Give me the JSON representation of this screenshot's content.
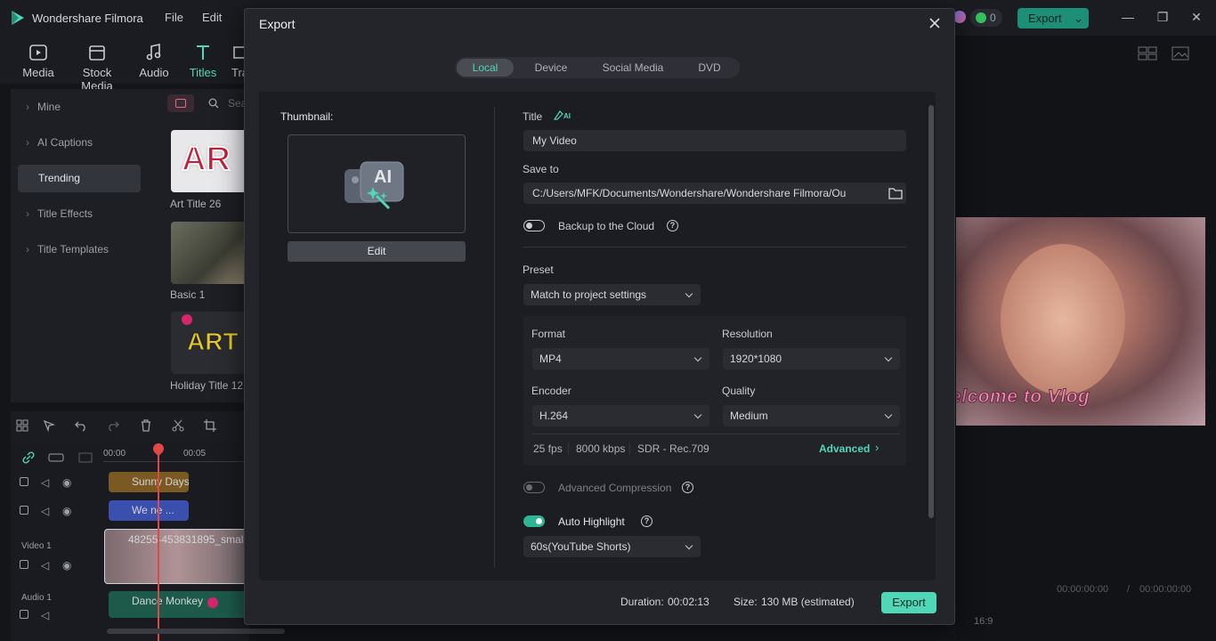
{
  "app": {
    "name": "Wondershare Filmora",
    "menu": [
      "File",
      "Edit"
    ],
    "credits": "0",
    "export_label": "Export"
  },
  "toolbar": [
    {
      "label": "Media",
      "icon": "media-icon"
    },
    {
      "label": "Stock Media",
      "icon": "stock-media-icon"
    },
    {
      "label": "Audio",
      "icon": "audio-icon"
    },
    {
      "label": "Titles",
      "icon": "titles-icon",
      "active": true
    },
    {
      "label": "Tra",
      "icon": "transitions-icon"
    }
  ],
  "leftnav": [
    "Mine",
    "AI Captions",
    "Trending",
    "Title Effects",
    "Title Templates"
  ],
  "search_placeholder": "Sea",
  "assets": [
    {
      "label": "Art Title 26",
      "art": "AR"
    },
    {
      "label": "Basic 1",
      "art": ""
    },
    {
      "label": "Holiday Title 12",
      "art": "ART"
    }
  ],
  "timeline": {
    "ruler": [
      "00:00",
      "00:05"
    ],
    "tracks": [
      {
        "name": "",
        "clip": "Sunny Days"
      },
      {
        "name": "",
        "clip": "We   ne ..."
      },
      {
        "name": "Video 1",
        "clip": "48255-453831895_small"
      },
      {
        "name": "Audio 1",
        "clip": "Dance Monkey"
      }
    ]
  },
  "preview": {
    "overlay_text": "elcome to Vlog",
    "timecode": "00:00:00:00",
    "timecode_total": "00:00:00:00",
    "aspect": "16:9"
  },
  "dialog": {
    "title": "Export",
    "tabs": [
      "Local",
      "Device",
      "Social Media",
      "DVD"
    ],
    "active_tab": "Local",
    "thumbnail_label": "Thumbnail:",
    "thumbnail_ai": "AI",
    "edit_label": "Edit",
    "title_label": "Title",
    "title_ai": "AI",
    "title_value": "My Video",
    "save_to_label": "Save to",
    "save_to_value": "C:/Users/MFK/Documents/Wondershare/Wondershare Filmora/Ou",
    "backup_label": "Backup to the Cloud",
    "backup_on": false,
    "preset_label": "Preset",
    "preset_value": "Match to project settings",
    "format_label": "Format",
    "format_value": "MP4",
    "resolution_label": "Resolution",
    "resolution_value": "1920*1080",
    "encoder_label": "Encoder",
    "encoder_value": "H.264",
    "quality_label": "Quality",
    "quality_value": "Medium",
    "fps": "25 fps",
    "bitrate": "8000 kbps",
    "color": "SDR - Rec.709",
    "advanced_label": "Advanced",
    "adv_compression_label": "Advanced Compression",
    "adv_compression_on": false,
    "auto_highlight_label": "Auto Highlight",
    "auto_highlight_on": true,
    "auto_highlight_value": "60s(YouTube Shorts)",
    "duration_label": "Duration:",
    "duration_value": "00:02:13",
    "size_label": "Size:",
    "size_value": "130 MB (estimated)",
    "export_label": "Export"
  },
  "colors": {
    "accent": "#4fd7b7",
    "panel": "#1c1d22",
    "dialog": "#24252b"
  }
}
